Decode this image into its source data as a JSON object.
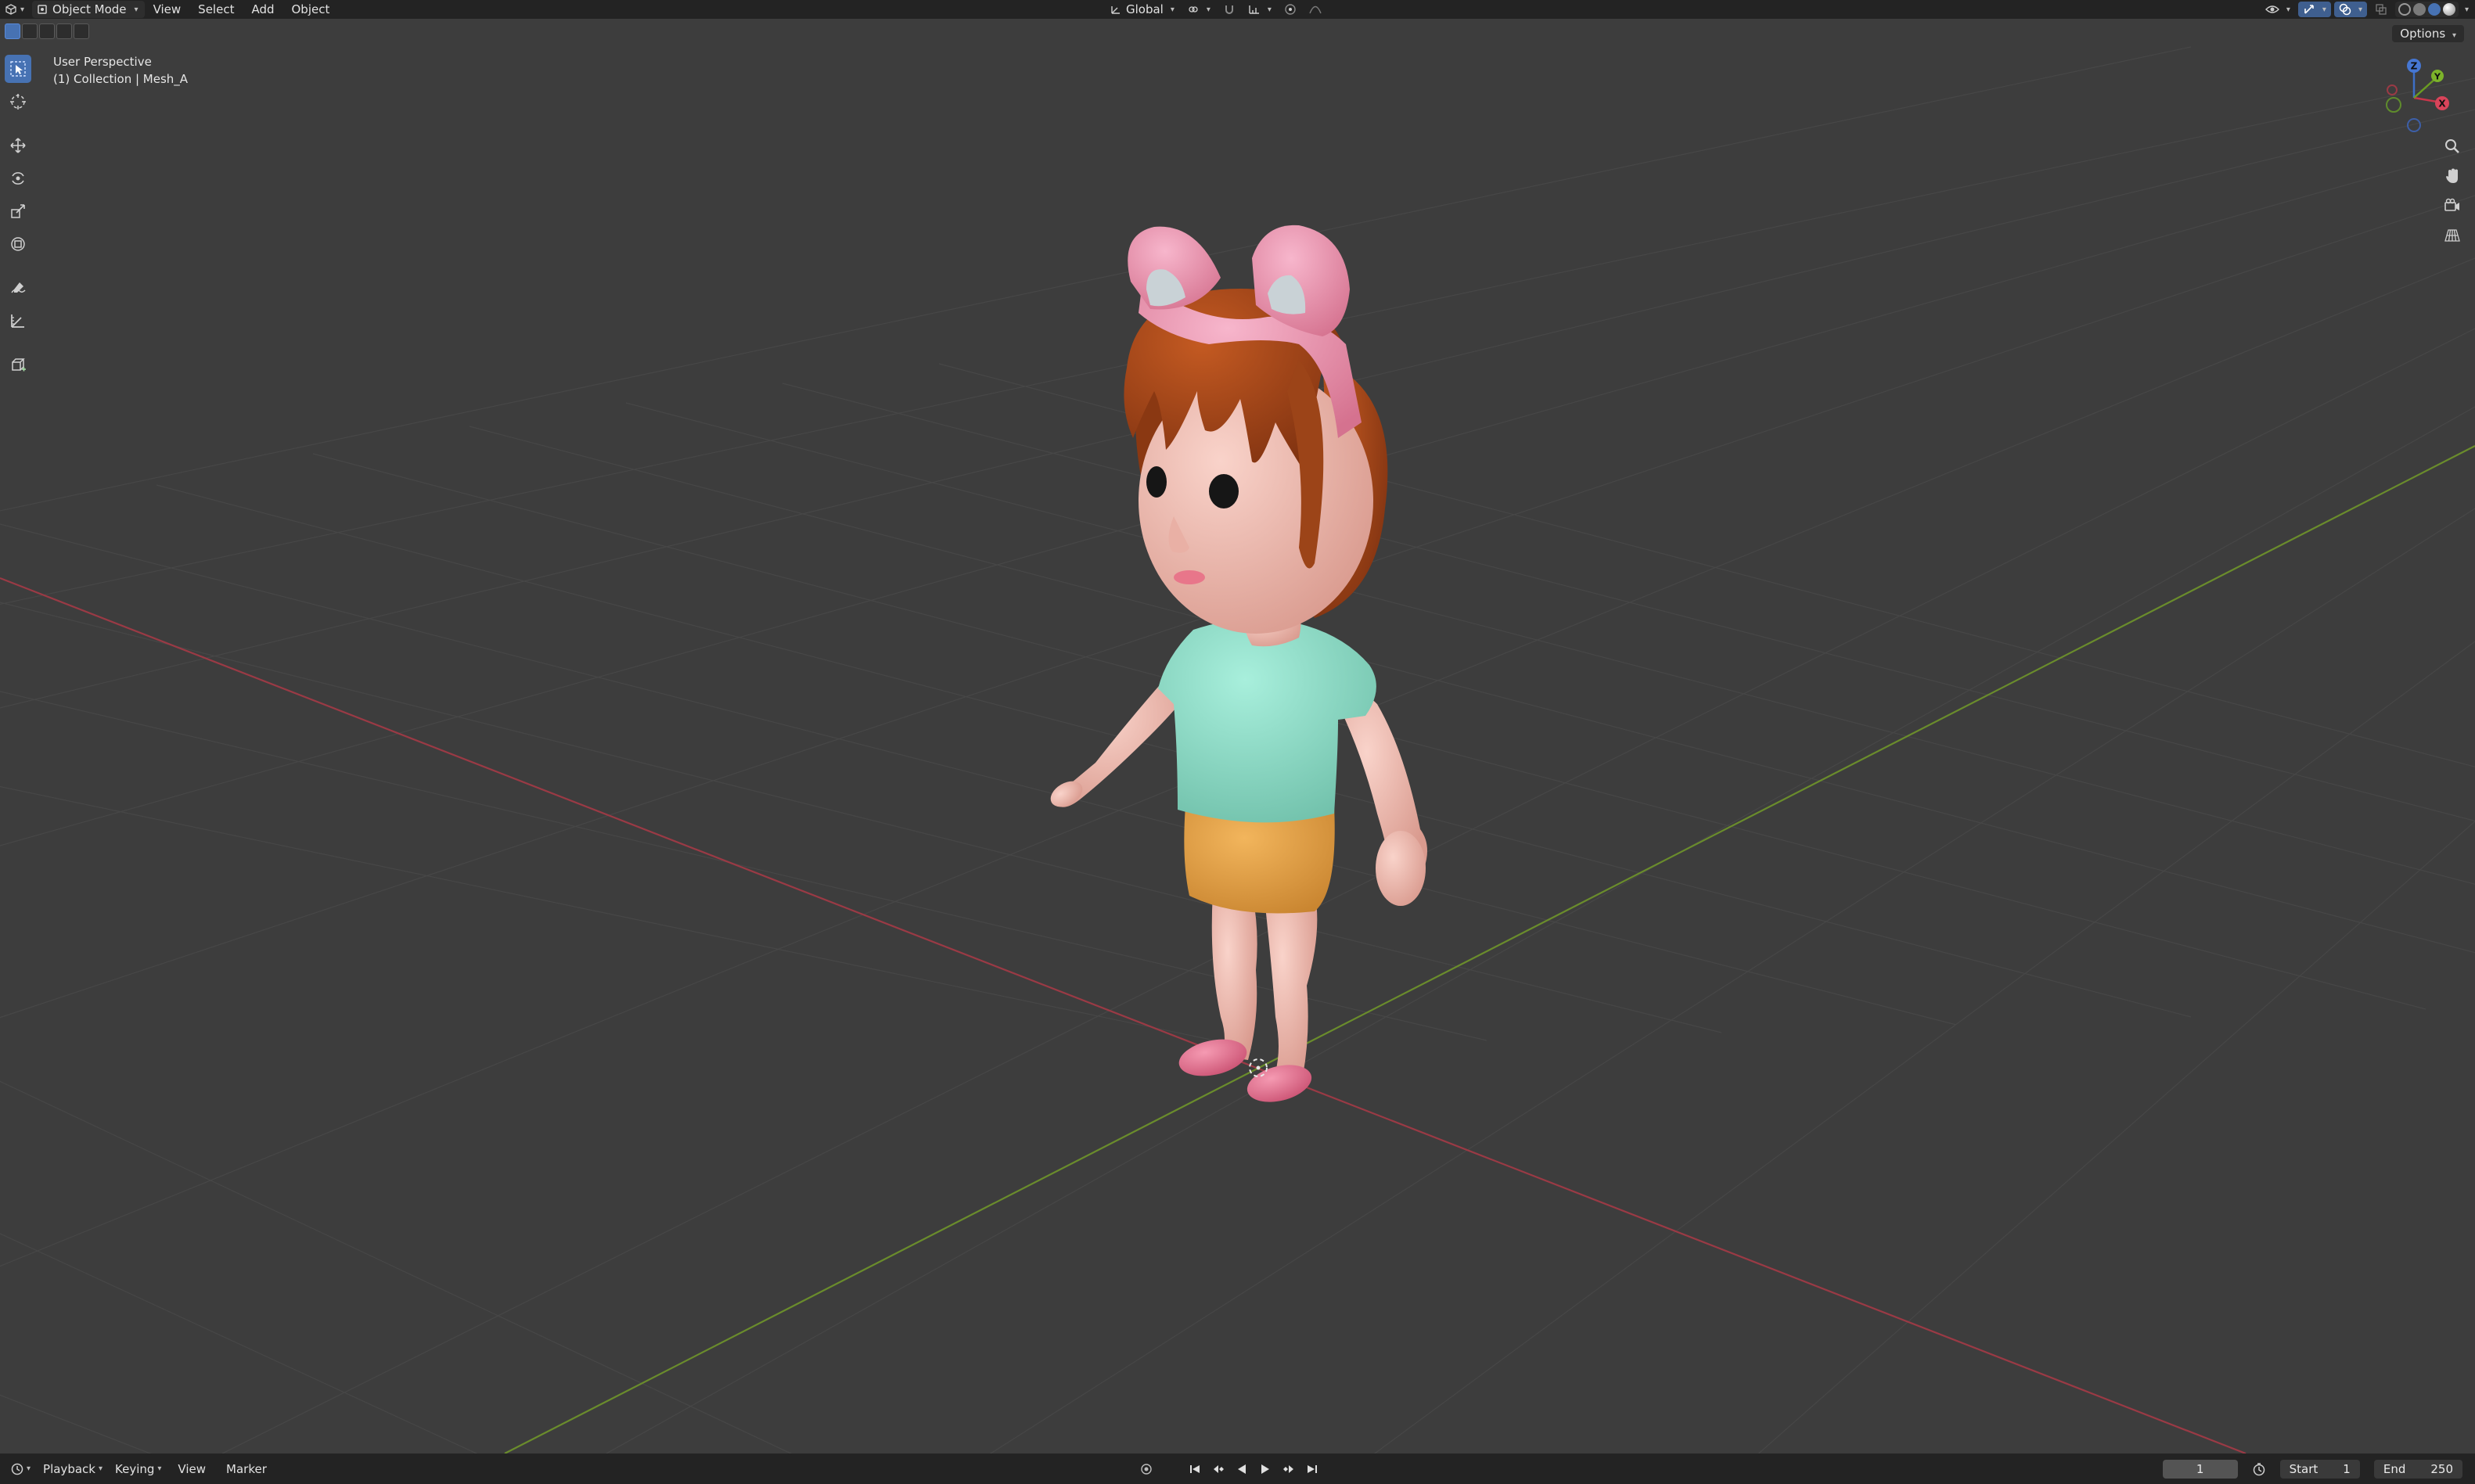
{
  "header": {
    "editor_type_icon": "view3d-icon",
    "mode": "Object Mode",
    "menus": [
      "View",
      "Select",
      "Add",
      "Object"
    ],
    "transform_orientation": "Global",
    "right_icons": [
      "visibility-icon",
      "gizmo-icon",
      "overlay-icon",
      "xray-icon",
      "wireframe-shading-icon",
      "solid-shading-icon",
      "material-shading-icon",
      "rendered-shading-icon"
    ]
  },
  "tool_header": {
    "options_label": "Options"
  },
  "toolbar": {
    "tools": [
      "select-box",
      "cursor",
      "move",
      "rotate",
      "scale",
      "transform",
      "annotate",
      "measure",
      "add-cube"
    ]
  },
  "viewport": {
    "perspective_label": "User Perspective",
    "collection_label": "(1) Collection | Mesh_A",
    "colors": {
      "background": "#3d3d3d",
      "grid": "#474747",
      "x_axis": "#9a3a45",
      "y_axis": "#6a8c2c",
      "hair": "#a8481b",
      "skin": "#f2c0b6",
      "shirt": "#8fdcc8",
      "skirt": "#e4a24a",
      "ears": "#f09ab8",
      "shoes": "#e8708f"
    },
    "gizmo_axes": {
      "x": "X",
      "y": "Y",
      "z": "Z"
    }
  },
  "timeline": {
    "menus": [
      "Playback",
      "Keying",
      "View",
      "Marker"
    ],
    "current_frame": "1",
    "start_label": "Start",
    "start_value": "1",
    "end_label": "End",
    "end_value": "250"
  }
}
